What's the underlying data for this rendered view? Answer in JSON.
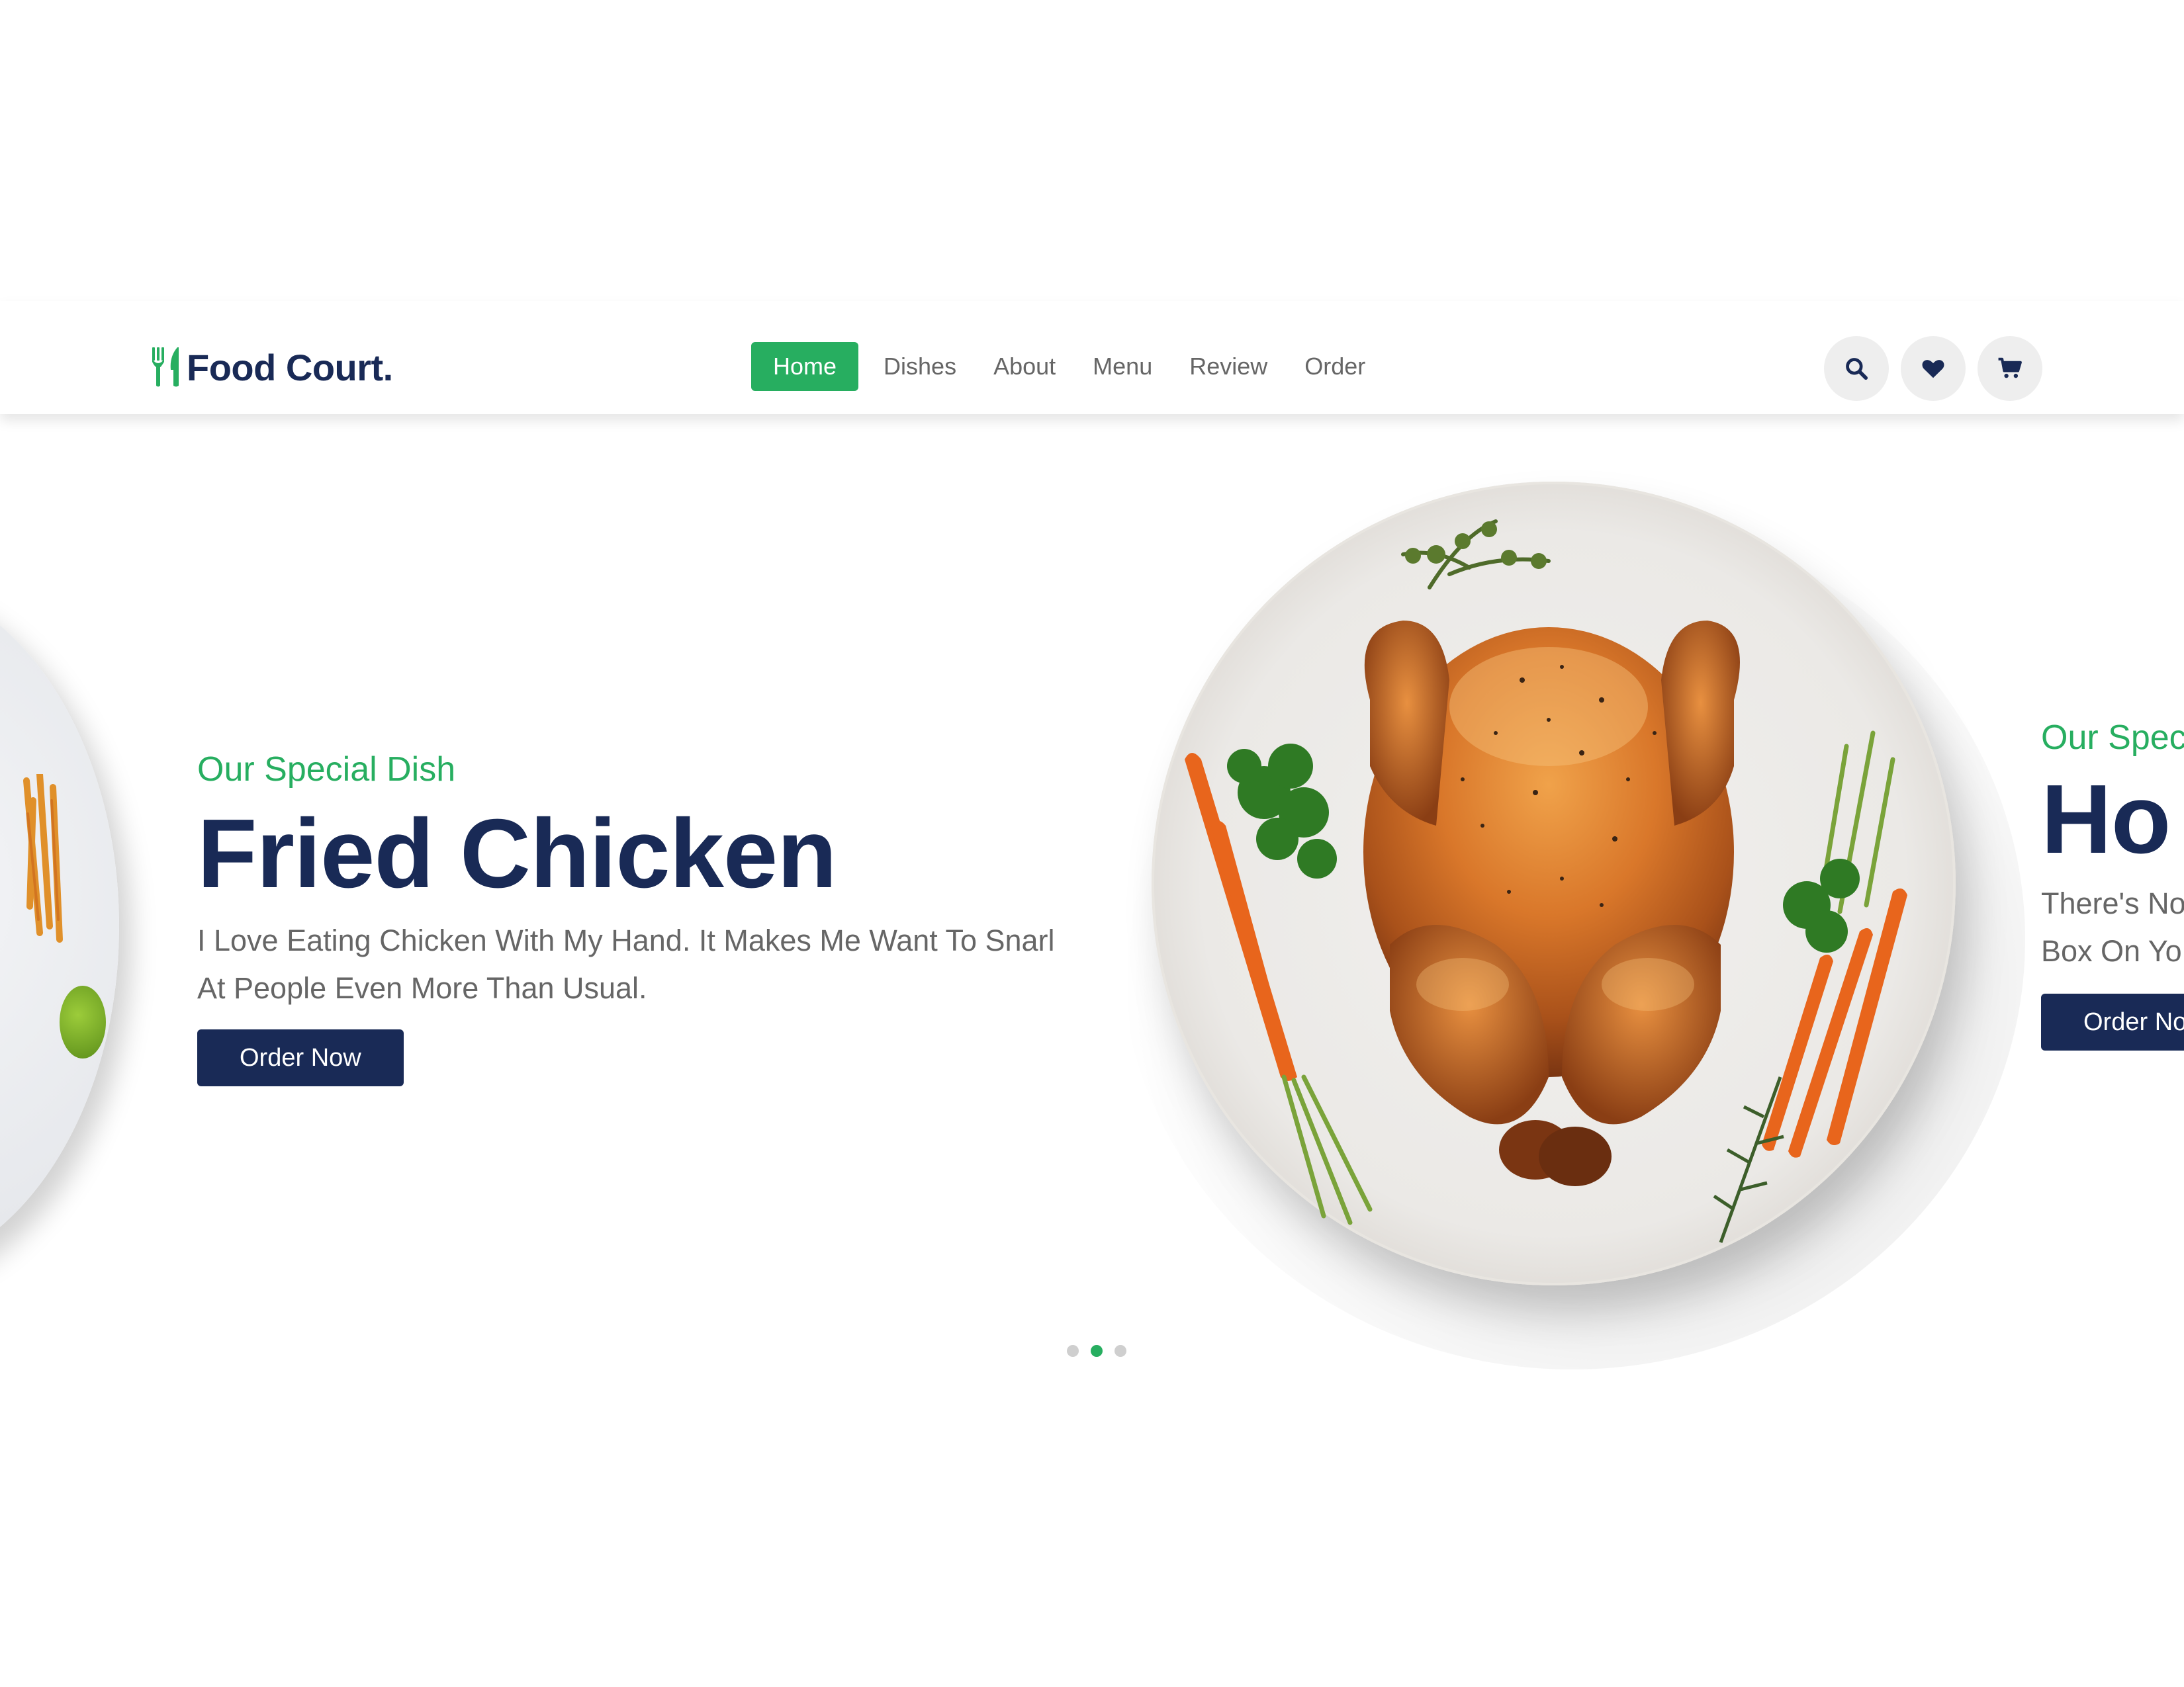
{
  "brand": {
    "logo_text": "Food Court.",
    "logo_icon": "utensils-icon",
    "accent": "#27ae60",
    "dark": "#192a56"
  },
  "nav": {
    "items": [
      {
        "label": "Home",
        "active": true
      },
      {
        "label": "Dishes",
        "active": false
      },
      {
        "label": "About",
        "active": false
      },
      {
        "label": "Menu",
        "active": false
      },
      {
        "label": "Review",
        "active": false
      },
      {
        "label": "Order",
        "active": false
      }
    ]
  },
  "header_icons": [
    "search-icon",
    "heart-icon",
    "cart-icon"
  ],
  "slides": {
    "current": {
      "subtitle": "Our Special Dish",
      "title": "Fried Chicken",
      "description": "I Love Eating Chicken With My Hand. It Makes Me Want To Snarl At People Even More Than Usual.",
      "button": "Order Now"
    },
    "next": {
      "subtitle": "Our Spec",
      "title": "Ho",
      "description_line1": "There's No",
      "description_line2": "Box On Yo",
      "button": "Order No"
    }
  },
  "pagination": {
    "count": 3,
    "active_index": 1
  }
}
